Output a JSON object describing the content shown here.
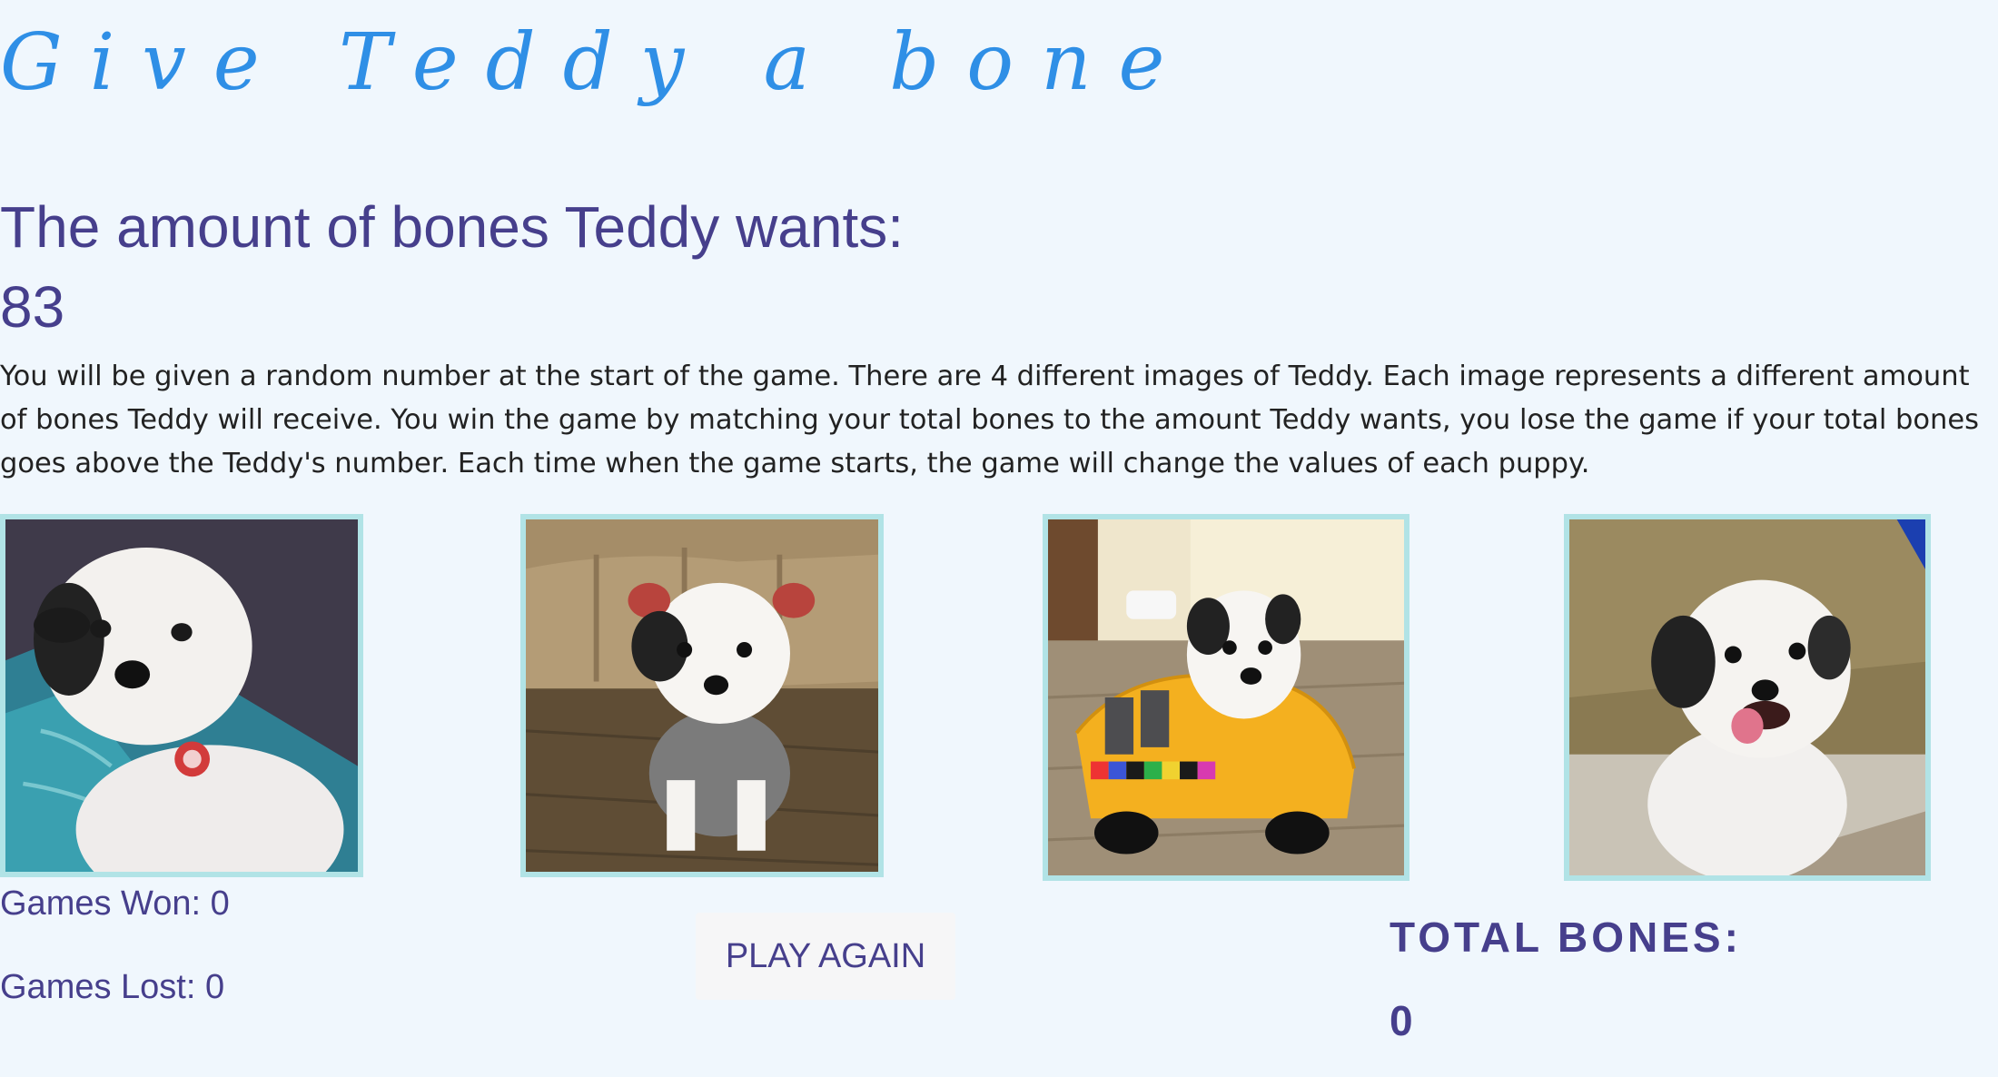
{
  "title": "Give Teddy a bone",
  "wants": {
    "heading": "The amount of bones Teddy wants:",
    "value": "83"
  },
  "instructions": "You will be given a random number at the start of the game. There are 4 different images of Teddy. Each image represents a different amount of bones Teddy will receive. You win the game by matching your total bones to the amount Teddy wants, you lose the game if your total bones goes above the Teddy's number. Each time when the game starts, the game will change the values of each puppy.",
  "puppies": [
    {
      "alt": "Teddy on a teal suitcase"
    },
    {
      "alt": "Teddy wearing a grey hoodie"
    },
    {
      "alt": "Teddy in a yellow toy taxi"
    },
    {
      "alt": "Teddy with tongue out"
    }
  ],
  "stats": {
    "won": "Games Won: 0",
    "lost": "Games Lost: 0"
  },
  "play_again_label": "PLAY AGAIN",
  "total": {
    "label": "TOTAL BONES:",
    "value": "0"
  },
  "colors": {
    "background": "#f0f7fd",
    "title": "#2f8fe6",
    "heading_text": "#463f8c",
    "image_border": "#b1e3e6"
  }
}
